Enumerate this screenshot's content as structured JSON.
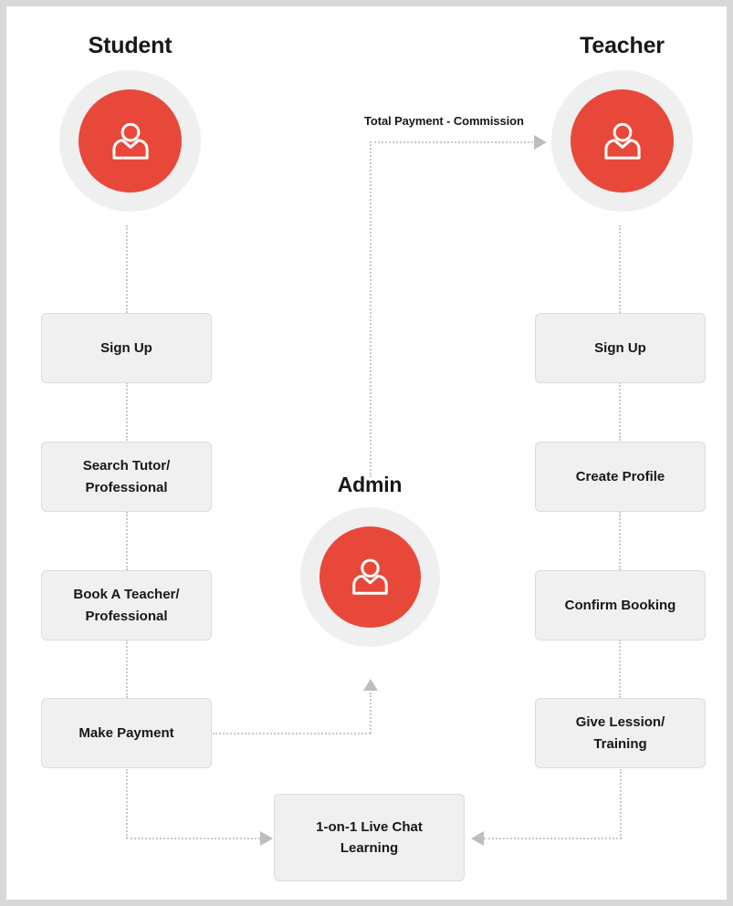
{
  "diagram": {
    "title_student": "Student",
    "title_teacher": "Teacher",
    "title_admin": "Admin",
    "actor_icon": "person-icon",
    "colors": {
      "accent": "#e8483a",
      "avatar_ring": "#efefef",
      "box_fill": "#f0f0f0",
      "box_border": "#dcdcdc",
      "connector": "#c9c9c9",
      "arrow": "#bdbdbd",
      "text": "#15181c",
      "frame": "#d8d8d8",
      "canvas": "#ffffff"
    },
    "student_steps": [
      {
        "label": "Sign Up"
      },
      {
        "label": "Search Tutor/\nProfessional"
      },
      {
        "label": "Book A Teacher/\nProfessional"
      },
      {
        "label": "Make Payment"
      }
    ],
    "teacher_steps": [
      {
        "label": "Sign Up"
      },
      {
        "label": "Create Profile"
      },
      {
        "label": "Confirm Booking"
      },
      {
        "label": "Give Lession/\nTraining"
      }
    ],
    "shared_step": {
      "label": "1-on-1 Live Chat\nLearning"
    },
    "edge_labels": [
      {
        "label": "Total Payment - Commission"
      }
    ]
  }
}
